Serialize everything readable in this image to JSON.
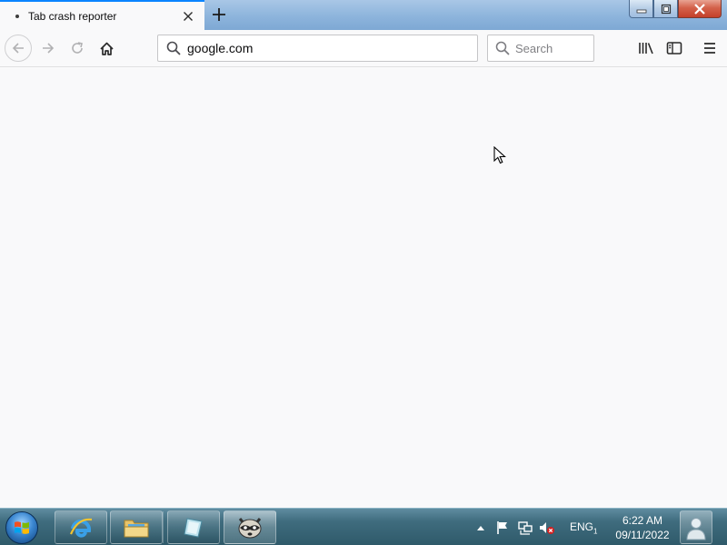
{
  "browser": {
    "tab": {
      "title": "Tab crash reporter"
    },
    "urlbar": {
      "value": "google.com"
    },
    "searchbar": {
      "placeholder": "Search"
    }
  },
  "icons": {
    "back": "arrow-left-icon",
    "forward": "arrow-right-icon",
    "reload": "reload-icon",
    "home": "home-icon",
    "library": "library-icon",
    "sidebar": "sidebar-icon",
    "menu": "hamburger-menu-icon"
  },
  "taskbar": {
    "items": [
      "internet-explorer",
      "file-explorer",
      "app",
      "raccoon-app"
    ],
    "language": "ENG",
    "language_sub": "1",
    "time": "6:22 AM",
    "date": "09/11/2022"
  },
  "colors": {
    "accent": "#0a84ff",
    "content_bg": "#f9f9fa"
  }
}
